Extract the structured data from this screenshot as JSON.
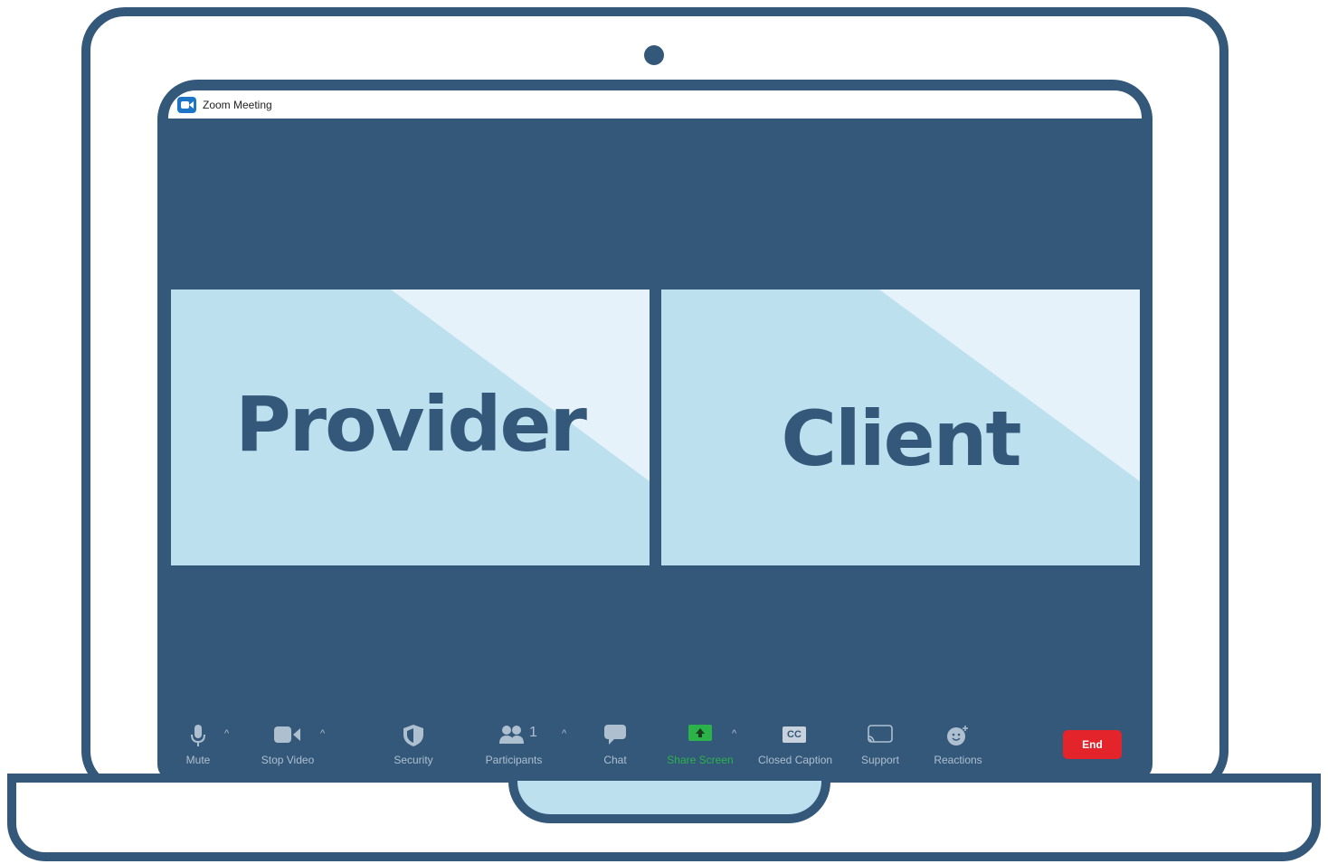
{
  "window": {
    "title": "Zoom Meeting"
  },
  "tiles": [
    {
      "label": "Provider"
    },
    {
      "label": "Client"
    }
  ],
  "toolbar": {
    "mute_label": "Mute",
    "stop_video_label": "Stop Video",
    "security_label": "Security",
    "participants_label": "Participants",
    "participants_count": "1",
    "chat_label": "Chat",
    "share_screen_label": "Share Screen",
    "closed_caption_label": "Closed Caption",
    "closed_caption_icon_text": "CC",
    "support_label": "Support",
    "reactions_label": "Reactions",
    "end_label": "End"
  },
  "colors": {
    "frame": "#34587a",
    "tile": "#bde0ef",
    "tile_corner": "#e6f2f9",
    "share_green": "#2bb34a",
    "end_red": "#e3242b",
    "zoom_blue": "#1e74c6"
  }
}
